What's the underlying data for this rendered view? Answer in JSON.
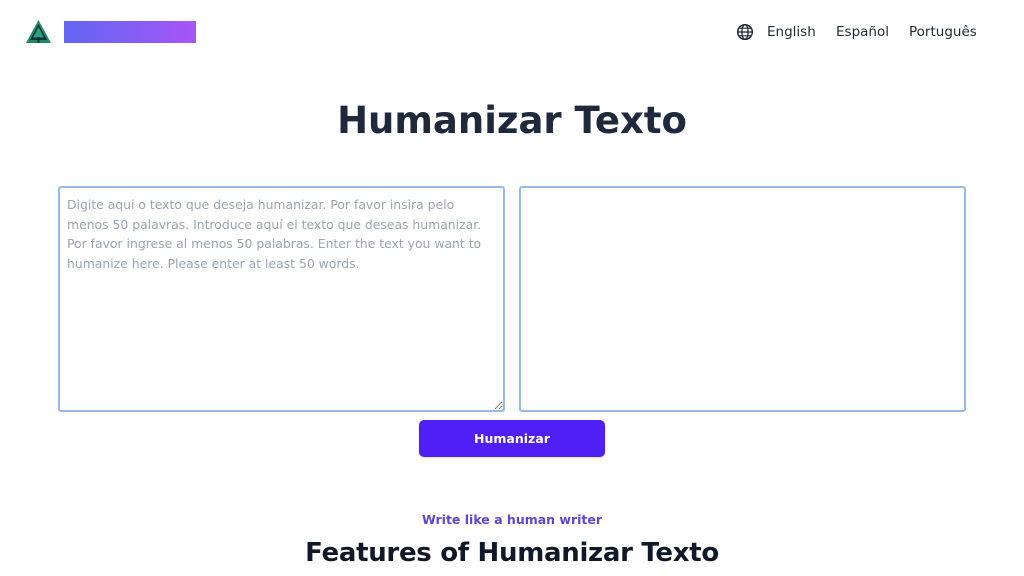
{
  "header": {
    "nav": {
      "languages": [
        {
          "label": "English"
        },
        {
          "label": "Español"
        },
        {
          "label": "Português"
        }
      ]
    }
  },
  "main": {
    "title": "Humanizar Texto",
    "input": {
      "value": "",
      "placeholder": "Digite aqui o texto que deseja humanizar. Por favor insira pelo menos 50 palavras. Introduce aquí el texto que deseas humanizar. Por favor ingrese al menos 50 palabras. Enter the text you want to humanize here. Please enter at least 50 words."
    },
    "output": {
      "value": ""
    },
    "humanize_button_label": "Humanizar"
  },
  "features": {
    "eyebrow": "Write like a human writer",
    "title": "Features of Humanizar Texto"
  },
  "colors": {
    "accent": "#4f1ff5",
    "brand_gradient_start": "#6366f1",
    "brand_gradient_end": "#a855f7",
    "eyebrow": "#5b45d6",
    "textarea_border": "#93bbe6",
    "logo": "#1f8a66"
  },
  "icons": {
    "logo": "tree-logo-icon",
    "language": "globe-icon"
  }
}
